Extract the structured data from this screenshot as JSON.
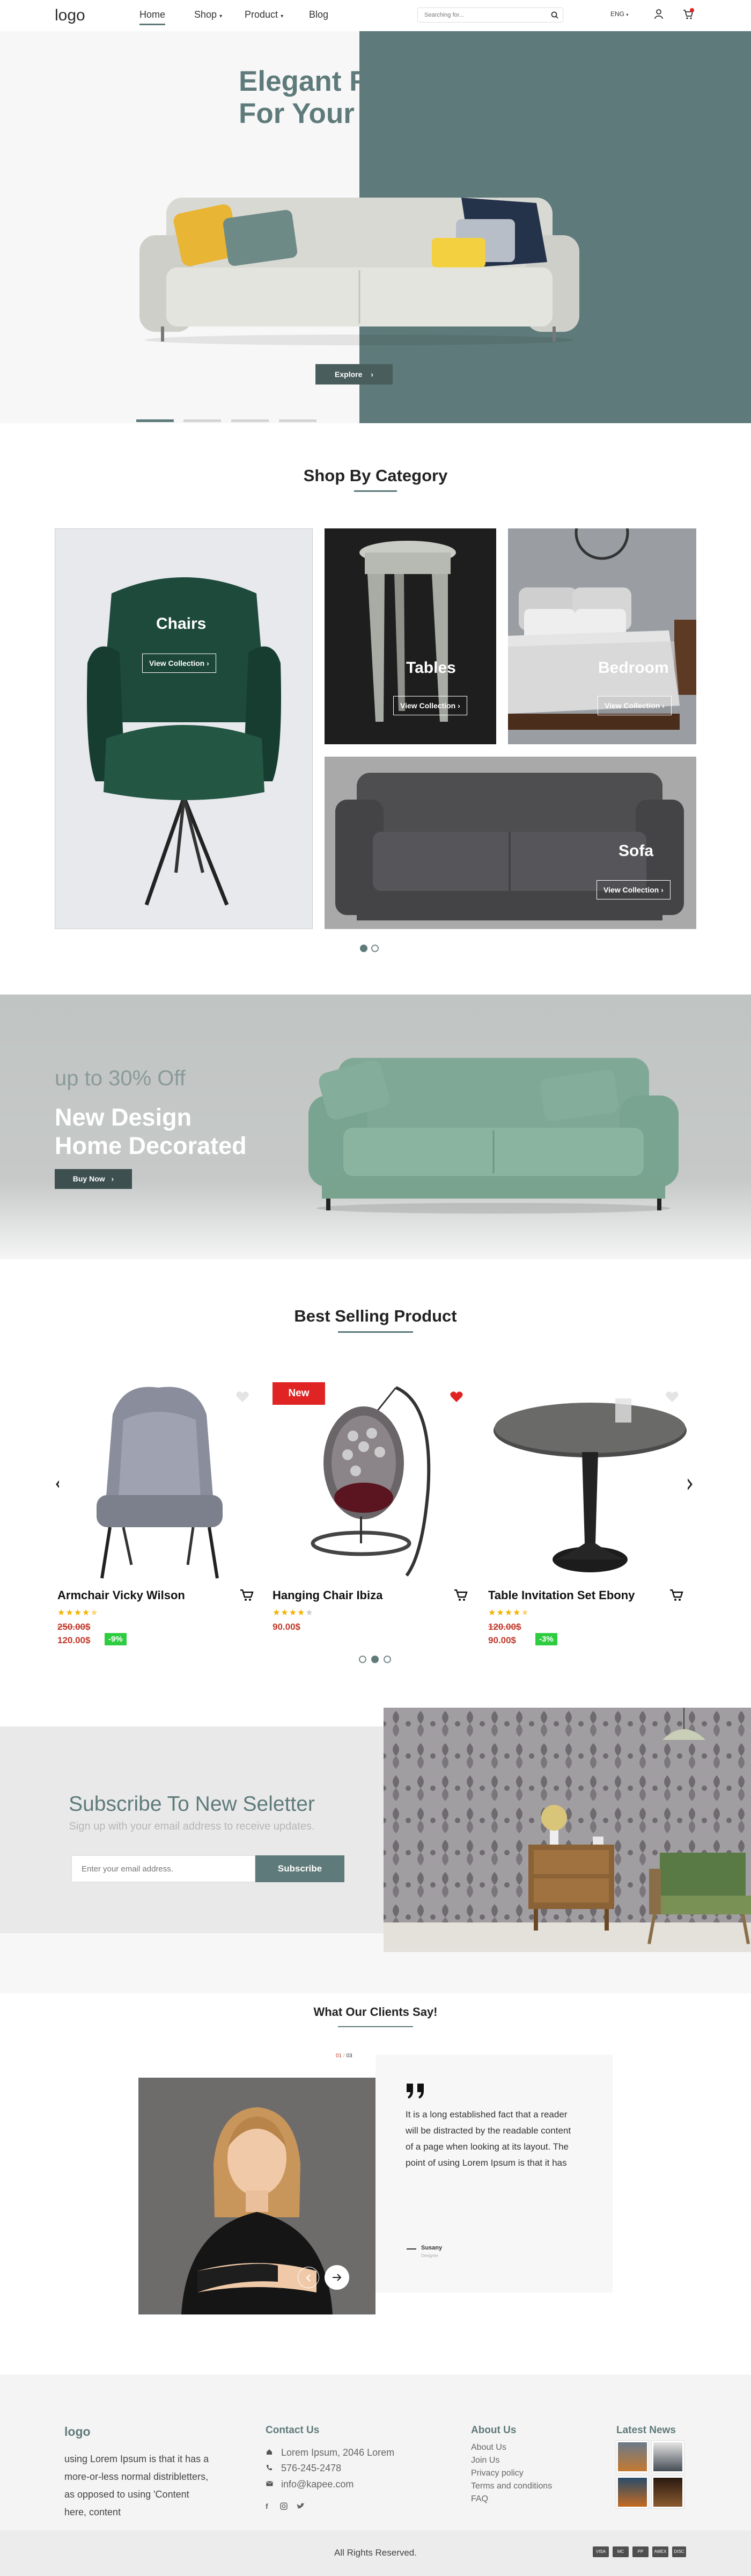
{
  "header": {
    "logo": "logo",
    "nav": {
      "home": "Home",
      "shop": "Shop",
      "product": "Product",
      "blog": "Blog"
    },
    "search_placeholder": "Searching for...",
    "language": "ENG"
  },
  "hero": {
    "title_line1": "Elegant Furniture",
    "title_line2": "For Your House",
    "explore": "Explore"
  },
  "categories": {
    "title": "Shop By Category",
    "items": [
      {
        "name": "Chairs",
        "cta": "View Collection"
      },
      {
        "name": "Tables",
        "cta": "View Collection"
      },
      {
        "name": "Bedroom",
        "cta": "View Collection"
      },
      {
        "name": "Sofa",
        "cta": "View Collection"
      }
    ]
  },
  "promo": {
    "discount": "up to 30% Off",
    "title_line1": "New Design",
    "title_line2": "Home Decorated",
    "cta": "Buy Now"
  },
  "best_selling": {
    "title": "Best Selling Product",
    "badge_new": "New",
    "products": [
      {
        "name": "Armchair Vicky Wilson",
        "rating": 4.5,
        "old_price": "250.00$",
        "price": "120.00$",
        "discount": "-9%"
      },
      {
        "name": "Hanging Chair Ibiza",
        "rating": 4,
        "price": "90.00$"
      },
      {
        "name": "Table Invitation Set Ebony",
        "rating": 4.5,
        "old_price": "120.00$",
        "price": "90.00$",
        "discount": "-3%"
      }
    ]
  },
  "subscribe": {
    "title": "Subscribe To New Seletter",
    "subtitle": "Sign up with your email address to receive updates.",
    "placeholder": "Enter your email address.",
    "button": "Subscribe"
  },
  "testimonial": {
    "title": "What Our Clients Say!",
    "counter_current": "01",
    "counter_sep": "/",
    "counter_total": "03",
    "quote": "It is a long established fact that a reader will be distracted by the readable content of a page when looking at its layout. The point of using Lorem Ipsum is that it has",
    "author": "Susany",
    "role": "Designer"
  },
  "footer": {
    "logo": "logo",
    "about_text": "using Lorem Ipsum is that it has a more-or-less normal distribletters, as opposed to using 'Content here, content",
    "contact_title": "Contact Us",
    "address": "Lorem Ipsum, 2046 Lorem",
    "phone": "576-245-2478",
    "email": "info@kapee.com",
    "about_title": "About Us",
    "about_links": [
      "About Us",
      "Join Us",
      "Privacy policy",
      "Terms and conditions",
      "FAQ"
    ],
    "news_title": "Latest News",
    "copyright": "All Rights Reserved.",
    "payments": [
      "VISA",
      "MC",
      "PP",
      "AMEX",
      "DISC"
    ]
  },
  "colors": {
    "accent": "#5f7a7a",
    "price_red": "#c0392b",
    "discount_green": "#2ecc40",
    "new_badge_red": "#e02424",
    "star": "#f0b400"
  }
}
